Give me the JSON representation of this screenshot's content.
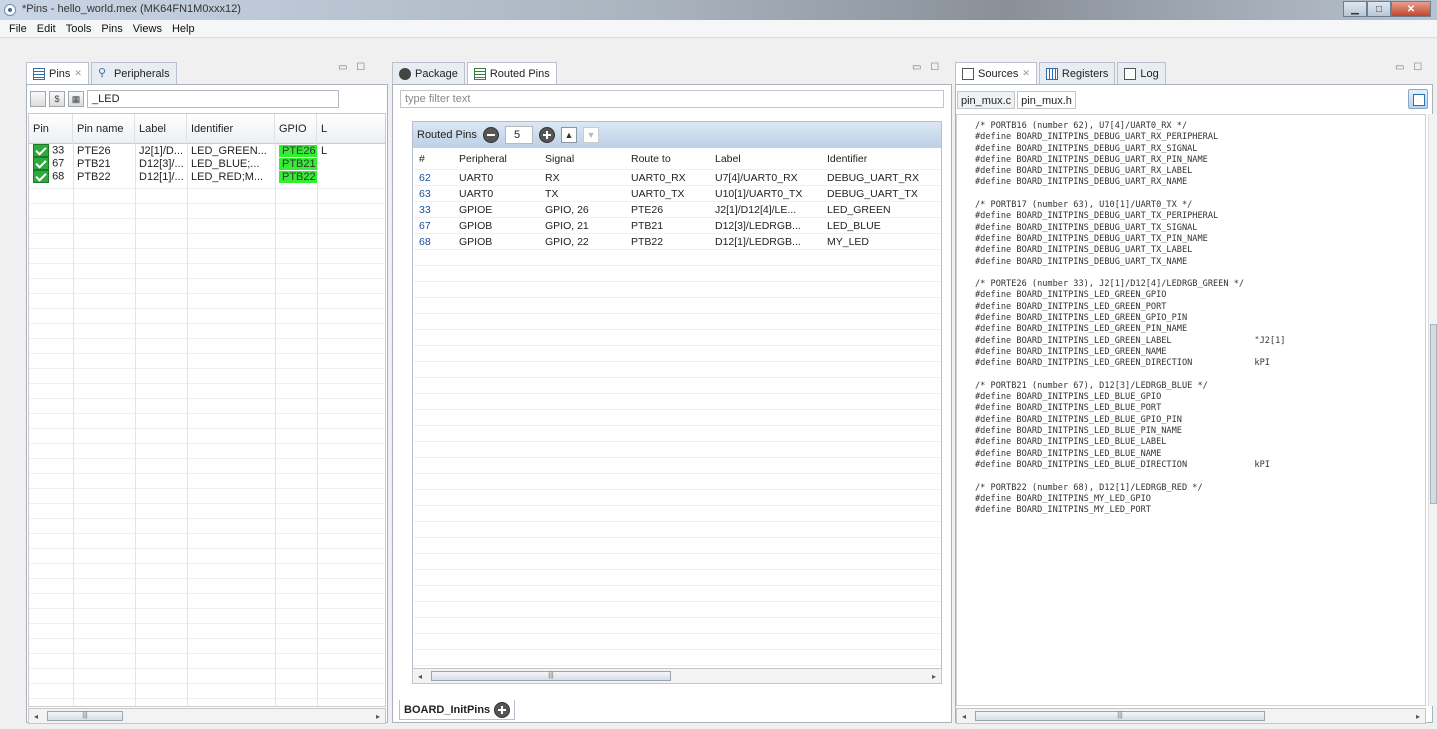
{
  "window": {
    "title": "*Pins - hello_world.mex (MK64FN1M0xxx12)"
  },
  "menu": [
    "File",
    "Edit",
    "Tools",
    "Pins",
    "Views",
    "Help"
  ],
  "left_panel": {
    "tabs": [
      "Pins",
      "Peripherals"
    ],
    "filter_value": "_LED",
    "columns": [
      "Pin",
      "Pin name",
      "Label",
      "Identifier",
      "GPIO",
      "L"
    ],
    "rows": [
      {
        "pin": "33",
        "name": "PTE26",
        "label": "J2[1]/D...",
        "identifier": "LED_GREEN...",
        "gpio": "PTE26",
        "extra": "L"
      },
      {
        "pin": "67",
        "name": "PTB21",
        "label": "D12[3]/...",
        "identifier": "LED_BLUE;...",
        "gpio": "PTB21",
        "extra": ""
      },
      {
        "pin": "68",
        "name": "PTB22",
        "label": "D12[1]/...",
        "identifier": "LED_RED;M...",
        "gpio": "PTB22",
        "extra": ""
      }
    ]
  },
  "middle_panel": {
    "tabs": [
      "Package",
      "Routed Pins"
    ],
    "filter_placeholder": "type filter text",
    "routed_title": "Routed Pins",
    "count": "5",
    "columns": [
      "#",
      "Peripheral",
      "Signal",
      "Route to",
      "Label",
      "Identifier"
    ],
    "rows": [
      {
        "num": "62",
        "peripheral": "UART0",
        "signal": "RX",
        "route": "UART0_RX",
        "label": "U7[4]/UART0_RX",
        "identifier": "DEBUG_UART_RX"
      },
      {
        "num": "63",
        "peripheral": "UART0",
        "signal": "TX",
        "route": "UART0_TX",
        "label": "U10[1]/UART0_TX",
        "identifier": "DEBUG_UART_TX"
      },
      {
        "num": "33",
        "peripheral": "GPIOE",
        "signal": "GPIO, 26",
        "route": "PTE26",
        "label": "J2[1]/D12[4]/LE...",
        "identifier": "LED_GREEN"
      },
      {
        "num": "67",
        "peripheral": "GPIOB",
        "signal": "GPIO, 21",
        "route": "PTB21",
        "label": "D12[3]/LEDRGB...",
        "identifier": "LED_BLUE"
      },
      {
        "num": "68",
        "peripheral": "GPIOB",
        "signal": "GPIO, 22",
        "route": "PTB22",
        "label": "D12[1]/LEDRGB...",
        "identifier": "MY_LED"
      }
    ],
    "bottom_tab": "BOARD_InitPins"
  },
  "right_panel": {
    "tabs": [
      "Sources",
      "Registers",
      "Log"
    ],
    "file_tabs": [
      "pin_mux.c",
      "pin_mux.h"
    ],
    "code": "/* PORTB16 (number 62), U7[4]/UART0_RX */\n#define BOARD_INITPINS_DEBUG_UART_RX_PERIPHERAL\n#define BOARD_INITPINS_DEBUG_UART_RX_SIGNAL\n#define BOARD_INITPINS_DEBUG_UART_RX_PIN_NAME\n#define BOARD_INITPINS_DEBUG_UART_RX_LABEL\n#define BOARD_INITPINS_DEBUG_UART_RX_NAME\n\n/* PORTB17 (number 63), U10[1]/UART0_TX */\n#define BOARD_INITPINS_DEBUG_UART_TX_PERIPHERAL\n#define BOARD_INITPINS_DEBUG_UART_TX_SIGNAL\n#define BOARD_INITPINS_DEBUG_UART_TX_PIN_NAME\n#define BOARD_INITPINS_DEBUG_UART_TX_LABEL\n#define BOARD_INITPINS_DEBUG_UART_TX_NAME\n\n/* PORTE26 (number 33), J2[1]/D12[4]/LEDRGB_GREEN */\n#define BOARD_INITPINS_LED_GREEN_GPIO\n#define BOARD_INITPINS_LED_GREEN_PORT\n#define BOARD_INITPINS_LED_GREEN_GPIO_PIN\n#define BOARD_INITPINS_LED_GREEN_PIN_NAME\n#define BOARD_INITPINS_LED_GREEN_LABEL                \"J2[1]\n#define BOARD_INITPINS_LED_GREEN_NAME\n#define BOARD_INITPINS_LED_GREEN_DIRECTION            kPI\n\n/* PORTB21 (number 67), D12[3]/LEDRGB_BLUE */\n#define BOARD_INITPINS_LED_BLUE_GPIO\n#define BOARD_INITPINS_LED_BLUE_PORT\n#define BOARD_INITPINS_LED_BLUE_GPIO_PIN\n#define BOARD_INITPINS_LED_BLUE_PIN_NAME\n#define BOARD_INITPINS_LED_BLUE_LABEL\n#define BOARD_INITPINS_LED_BLUE_NAME\n#define BOARD_INITPINS_LED_BLUE_DIRECTION             kPI\n\n/* PORTB22 (number 68), D12[1]/LEDRGB_RED */\n#define BOARD_INITPINS_MY_LED_GPIO\n#define BOARD_INITPINS_MY_LED_PORT"
  },
  "colors": {
    "gpio_highlight": "#33ee33",
    "check_green": "#2eaa3c",
    "routed_header": "#bdd0e6"
  }
}
